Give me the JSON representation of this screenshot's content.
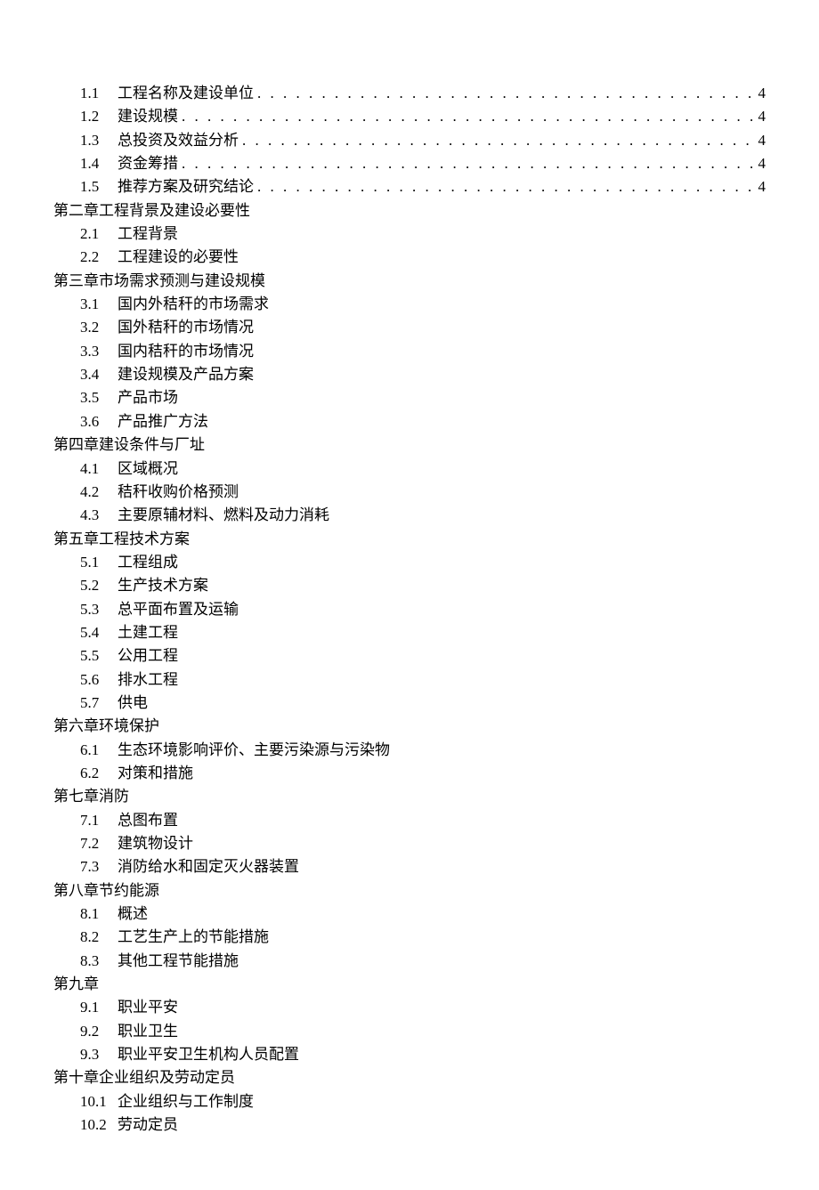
{
  "toc": [
    {
      "sections": [
        {
          "num": "1.1",
          "title": "工程名称及建设单位",
          "page": "4"
        },
        {
          "num": "1.2",
          "title": "建设规模",
          "page": "4"
        },
        {
          "num": "1.3",
          "title": "总投资及效益分析",
          "page": "4"
        },
        {
          "num": "1.4",
          "title": "资金筹措",
          "page": "4"
        },
        {
          "num": "1.5",
          "title": "推荐方案及研究结论",
          "page": "4"
        }
      ]
    },
    {
      "title": "第二章工程背景及建设必要性",
      "sections": [
        {
          "num": "2.1",
          "title": "工程背景"
        },
        {
          "num": "2.2",
          "title": "工程建设的必要性"
        }
      ]
    },
    {
      "title": "第三章市场需求预测与建设规模",
      "sections": [
        {
          "num": "3.1",
          "title": "国内外秸秆的市场需求"
        },
        {
          "num": "3.2",
          "title": "国外秸秆的市场情况"
        },
        {
          "num": "3.3",
          "title": "国内秸秆的市场情况"
        },
        {
          "num": "3.4",
          "title": "建设规模及产品方案"
        },
        {
          "num": "3.5",
          "title": "产品市场"
        },
        {
          "num": "3.6",
          "title": "产品推广方法"
        }
      ]
    },
    {
      "title": "第四章建设条件与厂址",
      "sections": [
        {
          "num": "4.1",
          "title": "区域概况"
        },
        {
          "num": "4.2",
          "title": "秸秆收购价格预测"
        },
        {
          "num": "4.3",
          "title": "主要原辅材料、燃料及动力消耗"
        }
      ]
    },
    {
      "title": "第五章工程技术方案",
      "sections": [
        {
          "num": "5.1",
          "title": "工程组成"
        },
        {
          "num": "5.2",
          "title": "生产技术方案"
        },
        {
          "num": "5.3",
          "title": "总平面布置及运输"
        },
        {
          "num": "5.4",
          "title": "土建工程"
        },
        {
          "num": "5.5",
          "title": "公用工程"
        },
        {
          "num": "5.6",
          "title": "排水工程"
        },
        {
          "num": "5.7",
          "title": "供电"
        }
      ]
    },
    {
      "title": "第六章环境保护",
      "sections": [
        {
          "num": "6.1",
          "title": "生态环境影响评价、主要污染源与污染物"
        },
        {
          "num": "6.2",
          "title": "对策和措施"
        }
      ]
    },
    {
      "title": "第七章消防",
      "sections": [
        {
          "num": "7.1",
          "title": "总图布置"
        },
        {
          "num": "7.2",
          "title": "建筑物设计"
        },
        {
          "num": "7.3",
          "title": "消防给水和固定灭火器装置"
        }
      ]
    },
    {
      "title": "第八章节约能源",
      "sections": [
        {
          "num": "8.1",
          "title": "概述"
        },
        {
          "num": "8.2",
          "title": "工艺生产上的节能措施"
        },
        {
          "num": "8.3",
          "title": "其他工程节能措施"
        }
      ]
    },
    {
      "title": "第九章",
      "sections": [
        {
          "num": "9.1",
          "title": "职业平安"
        },
        {
          "num": "9.2",
          "title": "职业卫生"
        },
        {
          "num": "9.3",
          "title": "职业平安卫生机构人员配置"
        }
      ]
    },
    {
      "title": "第十章企业组织及劳动定员",
      "sections": [
        {
          "num": "10.1",
          "title": "企业组织与工作制度"
        },
        {
          "num": "10.2",
          "title": "劳动定员"
        }
      ]
    }
  ],
  "dot_fill": ". . . . . . . . . . . . . . . . . . . . . . . . . . . . . . . . . . . . . . . . . . . . . . . . . . . . . . . . . . . . . . . . . . . . . . . . . . . . . . . . . . . . . . . . . . . . . . . . . . . . . . . . . . . . . . . . . . . . . . . . . . . . ."
}
